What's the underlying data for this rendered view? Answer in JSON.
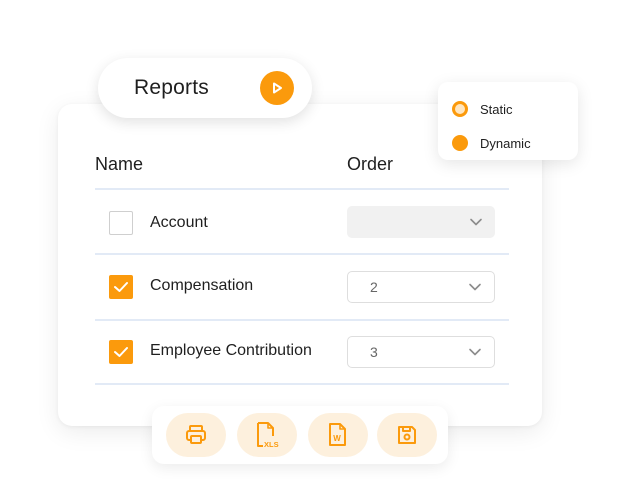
{
  "header": {
    "title": "Reports"
  },
  "legend": {
    "items": [
      {
        "label": "Static"
      },
      {
        "label": "Dynamic"
      }
    ]
  },
  "table": {
    "columns": {
      "name": "Name",
      "order": "Order"
    },
    "rows": [
      {
        "name": "Account",
        "checked": false,
        "order": ""
      },
      {
        "name": "Compensation",
        "checked": true,
        "order": "2"
      },
      {
        "name": "Employee Contribution",
        "checked": true,
        "order": "3"
      }
    ]
  },
  "toolbar": {
    "xls_label": "XLS",
    "word_label": "W"
  },
  "colors": {
    "accent": "#fb9a0c",
    "accent_light": "#fdf0dd",
    "divider": "#e2eaf6"
  },
  "icons": [
    "play-icon",
    "print-icon",
    "xls-file-icon",
    "word-file-icon",
    "save-icon",
    "chevron-down-icon",
    "checkmark-icon"
  ]
}
